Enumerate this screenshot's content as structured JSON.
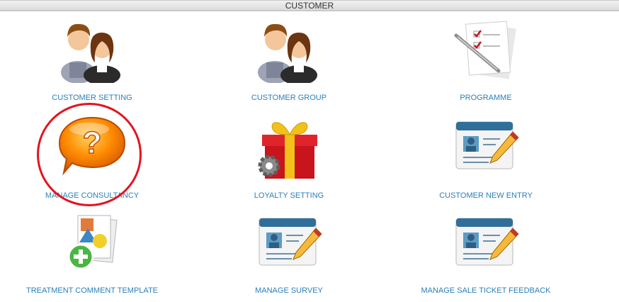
{
  "header": {
    "title": "CUSTOMER"
  },
  "tiles": [
    {
      "label": "CUSTOMER SETTING",
      "icon": "people-icon"
    },
    {
      "label": "CUSTOMER GROUP",
      "icon": "people-icon"
    },
    {
      "label": "PROGRAMME",
      "icon": "checklist-pen-icon"
    },
    {
      "label": "MANAGE CONSULTANCY",
      "icon": "question-bubble-icon"
    },
    {
      "label": "LOYALTY SETTING",
      "icon": "gift-gear-icon"
    },
    {
      "label": "CUSTOMER NEW ENTRY",
      "icon": "id-card-pencil-icon"
    },
    {
      "label": "TREATMENT COMMENT TEMPLATE",
      "icon": "document-add-icon"
    },
    {
      "label": "MANAGE SURVEY",
      "icon": "id-card-pencil-icon"
    },
    {
      "label": "MANAGE SALE TICKET FEEDBACK",
      "icon": "id-card-pencil-icon"
    }
  ],
  "colors": {
    "link": "#2a7fba",
    "highlight": "#e3141f"
  }
}
